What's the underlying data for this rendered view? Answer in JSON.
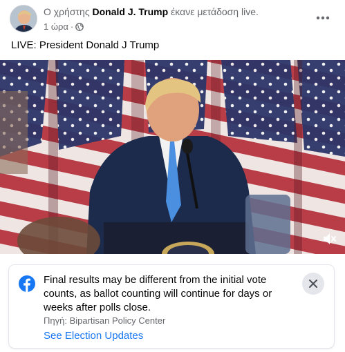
{
  "post": {
    "author_prefix": "Ο χρήστης",
    "author_name": "Donald J. Trump",
    "action": "έκανε μετάδοση live.",
    "time": "1 ώρα",
    "privacy_icon": "globe-icon",
    "text": "LIVE: President Donald J Trump"
  },
  "video": {
    "mute_icon": "speaker-muted-icon"
  },
  "notice": {
    "icon": "facebook-logo-icon",
    "text": "Final results may be different from the initial vote counts, as ballot counting will continue for days or weeks after polls close.",
    "source": "Πηγή: Bipartisan Policy Center",
    "link_label": "See Election Updates",
    "close_icon": "close-icon"
  },
  "colors": {
    "link": "#1877f2",
    "secondary_text": "#65676b",
    "facebook_blue": "#1877f2"
  }
}
